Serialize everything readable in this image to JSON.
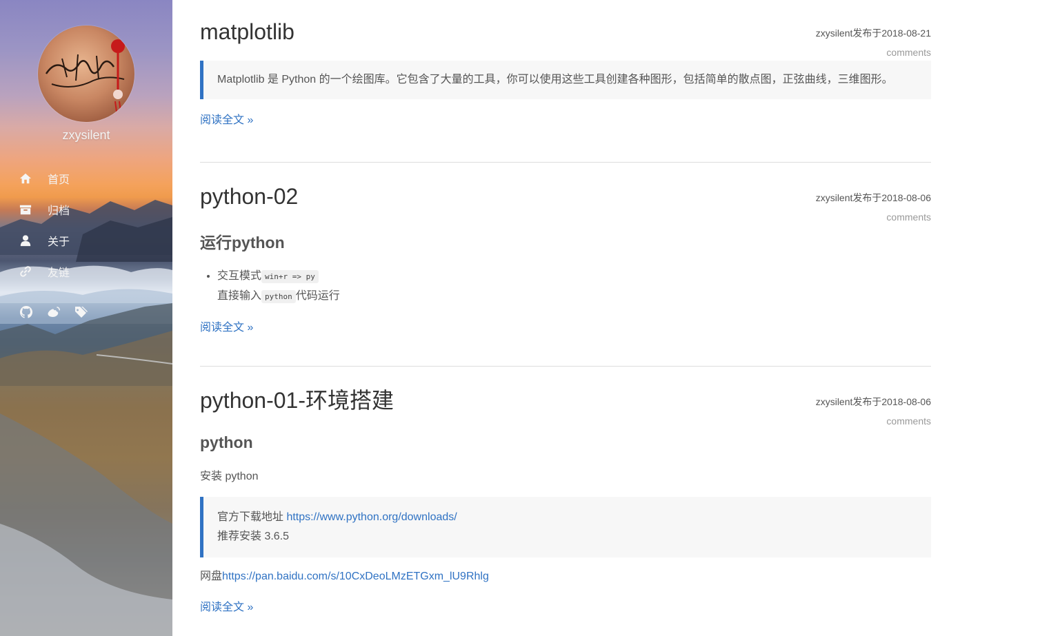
{
  "sidebar": {
    "blog_name": "zxysilent",
    "nav": [
      {
        "label": "首页",
        "icon": "home-icon"
      },
      {
        "label": "归档",
        "icon": "archive-icon"
      },
      {
        "label": "关于",
        "icon": "user-icon"
      },
      {
        "label": "友链",
        "icon": "link-icon"
      }
    ],
    "social": [
      "github-icon",
      "weibo-icon",
      "tag-icon"
    ]
  },
  "posts": [
    {
      "title": "matplotlib",
      "date": "zxysilent发布于2018-08-21",
      "comments": "comments",
      "quote": "Matplotlib 是 Python 的一个绘图库。它包含了大量的工具，你可以使用这些工具创建各种图形，包括简单的散点图，正弦曲线，三维图形。",
      "read_more": "阅读全文 »"
    },
    {
      "title": "python-02",
      "date": "zxysilent发布于2018-08-06",
      "comments": "comments",
      "heading": "运行python",
      "item_text": "交互模式",
      "item_code": "win+r => py",
      "line2_text": "直接输入",
      "line2_code": "python",
      "line2_after": "代码运行",
      "read_more": "阅读全文 »"
    },
    {
      "title": "python-01-环境搭建",
      "date": "zxysilent发布于2018-08-06",
      "comments": "comments",
      "heading": "python",
      "para": "安装 python",
      "quote_label": "官方下载地址 ",
      "quote_link": "https://www.python.org/downloads/",
      "quote_line2": "推荐安装 3.6.5",
      "pan_label": "网盘",
      "pan_link": "https://pan.baidu.com/s/10CxDeoLMzETGxm_lU9Rhlg",
      "read_more": "阅读全文 »"
    }
  ],
  "colors": {
    "accent": "#2f72c3"
  }
}
